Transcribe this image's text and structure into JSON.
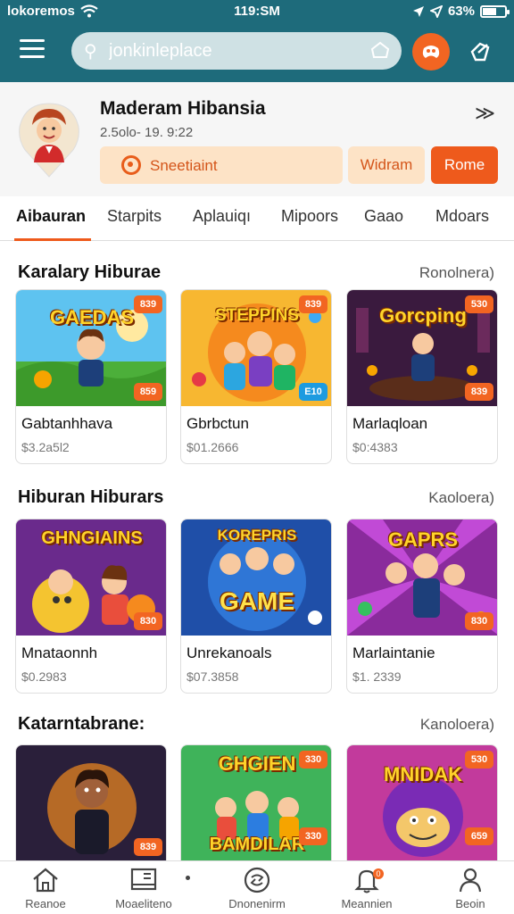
{
  "status_bar": {
    "carrier": "lokoremos",
    "time": "119:SM",
    "battery": "63%",
    "battery_level": 0.63
  },
  "header": {
    "search_placeholder": "jonkinleplace"
  },
  "profile": {
    "name": "Maderam Hibansia",
    "date": "2.5olo- 19. 9:22",
    "primary_button": "Sneetiaint",
    "secondary_button": "Widram",
    "cta_button": "Rome"
  },
  "tabs": [
    "Aibauran",
    "Starpits",
    "Aplauiqı",
    "Mipoors",
    "Gaao",
    "Mdoars"
  ],
  "sections": [
    {
      "title": "Karalary Hiburae",
      "more": "Ronolnera)",
      "cards": [
        {
          "name": "Gabtanhhava",
          "price": "$3.2a5l2",
          "art_text": "GAEDAS",
          "badge_top": "839",
          "badge_bottom": "859"
        },
        {
          "name": "Gbrbctun",
          "price": "$01.2666",
          "art_text": "STEPPINS",
          "badge_top": "839",
          "badge_bottom": "E10"
        },
        {
          "name": "Marlaqloan",
          "price": "$0:4383",
          "art_text": "Gorcping",
          "badge_top": "530",
          "badge_bottom": "839"
        }
      ]
    },
    {
      "title": "Hiburan Hiburars",
      "more": "Kaoloera)",
      "cards": [
        {
          "name": "Mnataonnh",
          "price": "$0.2983",
          "art_text": "GHNGIAINS",
          "badge_top": "",
          "badge_bottom": "830"
        },
        {
          "name": "Unrekanoals",
          "price": "$07.3858",
          "art_text": "GAME",
          "badge_top": "",
          "badge_bottom": ""
        },
        {
          "name": "Marlaintanie",
          "price": "$1. 2339",
          "art_text": "GAPRS",
          "badge_top": "",
          "badge_bottom": "830"
        }
      ]
    },
    {
      "title": "Katarntabrane:",
      "more": "Kanoloera)",
      "cards": [
        {
          "name": "",
          "price": "",
          "art_text": "",
          "badge_top": "",
          "badge_bottom": "839"
        },
        {
          "name": "",
          "price": "",
          "art_text": "GHGIEN",
          "art_text2": "BAMDILAR",
          "badge_top": "330",
          "badge_bottom": "330"
        },
        {
          "name": "",
          "price": "",
          "art_text": "MNIDAK",
          "badge_top": "530",
          "badge_bottom": "659"
        }
      ]
    }
  ],
  "bottom_nav": [
    "Reanoe",
    "Moaeliteno",
    "Dnonenirm",
    "Meannien",
    "Beoin"
  ],
  "notification_count": "0",
  "colors": {
    "header": "#1e6b7b",
    "accent": "#ee5a1c",
    "accent_soft": "#fde3c6"
  }
}
